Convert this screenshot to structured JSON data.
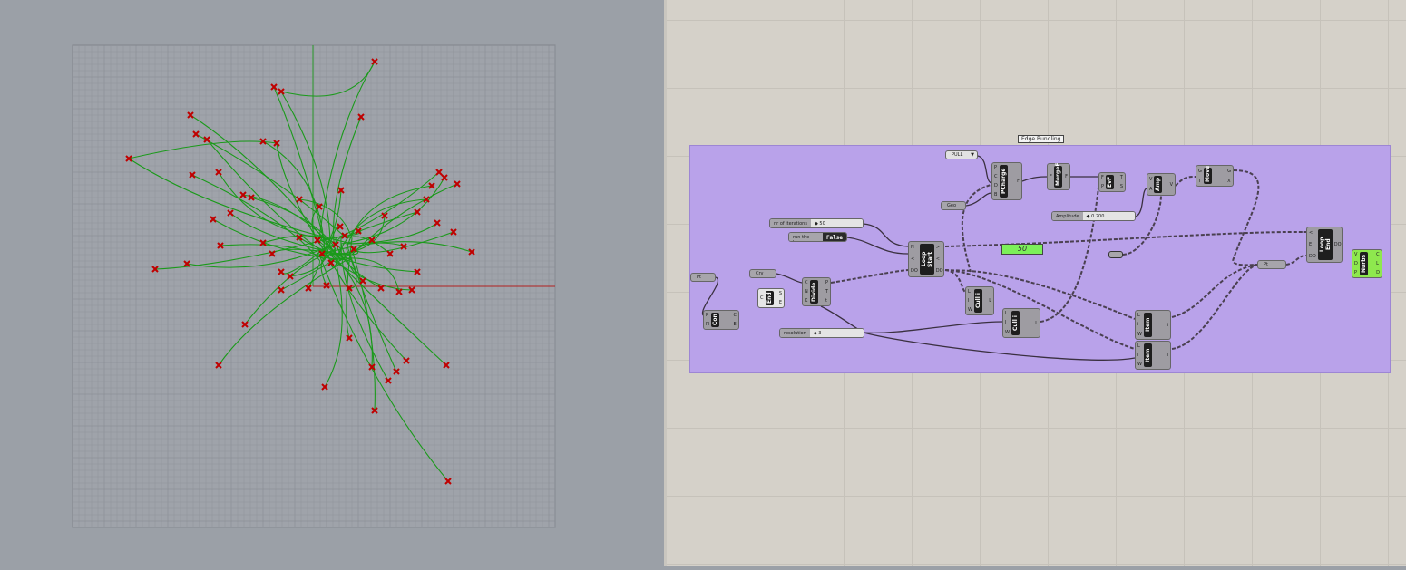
{
  "group_label": "Edge Bundling",
  "value_list": {
    "selected": "PULL"
  },
  "params": {
    "geo": "Geo",
    "pt1": "Pt",
    "crv": "Crv",
    "pt2": "Pt"
  },
  "sliders": {
    "iterations": {
      "label": "nr of iterations",
      "value": "50"
    },
    "amplitude": {
      "label": "Amplitude",
      "value": "0.200"
    },
    "resolution": {
      "label": "resolution",
      "value": "3"
    }
  },
  "toggle": {
    "label": "run the loop",
    "value": "False"
  },
  "panel": {
    "value": "50"
  },
  "components": {
    "pcharge": {
      "name": "PCharge",
      "in": [
        "P",
        "C",
        "D",
        "B"
      ],
      "out": [
        "F"
      ]
    },
    "mergef": {
      "name": "MergeF",
      "in": [
        "F"
      ],
      "out": [
        "F"
      ]
    },
    "evf": {
      "name": "EvF",
      "in": [
        "F",
        "P"
      ],
      "out": [
        "T",
        "S"
      ]
    },
    "amp": {
      "name": "Amp",
      "in": [
        "V",
        "A"
      ],
      "out": [
        "V"
      ]
    },
    "move": {
      "name": "Move",
      "in": [
        "G",
        "T"
      ],
      "out": [
        "G",
        "X"
      ]
    },
    "loopstart": {
      "name": "Loop Start",
      "in": [
        "N",
        "<",
        "DO"
      ],
      "out": [
        ">",
        "<",
        "DO"
      ]
    },
    "loopend": {
      "name": "Loop End",
      "in": [
        "<",
        "E",
        "DO"
      ],
      "out": [
        "DO"
      ]
    },
    "nurbs": {
      "name": "Nurbs",
      "in": [
        "V",
        "D",
        "P"
      ],
      "out": [
        "C",
        "L",
        "D"
      ]
    },
    "con": {
      "name": "Con",
      "in": [
        "P",
        "Pl"
      ],
      "out": [
        "C",
        "E"
      ]
    },
    "end": {
      "name": "End",
      "in": [
        "C"
      ],
      "out": [
        "S",
        "E"
      ]
    },
    "divide": {
      "name": "Divide",
      "in": [
        "C",
        "N",
        "K"
      ],
      "out": [
        "P",
        "T",
        "t"
      ]
    },
    "cull1": {
      "name": "Cull i",
      "in": [
        "L",
        "I",
        "W"
      ],
      "out": [
        "L"
      ]
    },
    "cull2": {
      "name": "Cull i",
      "in": [
        "L",
        "I",
        "W"
      ],
      "out": [
        "L"
      ]
    },
    "item1": {
      "name": "Item",
      "in": [
        "L",
        "i",
        "W"
      ],
      "out": [
        "i"
      ]
    },
    "item2": {
      "name": "Item",
      "in": [
        "L",
        "i",
        "W"
      ],
      "out": [
        "i"
      ]
    }
  },
  "colors": {
    "group": "#b9a2ea",
    "panel": "#7cf05a",
    "curve": "#1a9a1a",
    "point": "#c00000"
  }
}
